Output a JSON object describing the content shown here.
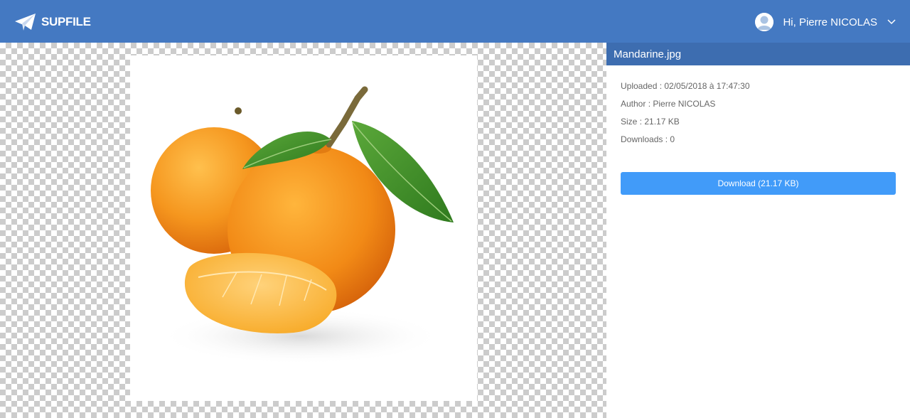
{
  "header": {
    "brand": "SUPFILE",
    "greeting": "Hi, Pierre NICOLAS",
    "icons": {
      "logo": "paper-plane-icon",
      "avatar": "user-avatar-icon",
      "menu": "chevron-down-icon"
    }
  },
  "file": {
    "name": "Mandarine.jpg",
    "uploaded": "Uploaded : 02/05/2018 à 17:47:30",
    "author": "Author : Pierre NICOLAS",
    "size": "Size : 21.17 KB",
    "downloads": "Downloads : 0",
    "download_label": "Download (21.17 KB)"
  },
  "colors": {
    "header": "#4479c2",
    "title_bar": "#3d6db0",
    "download_button": "#419bf9"
  }
}
